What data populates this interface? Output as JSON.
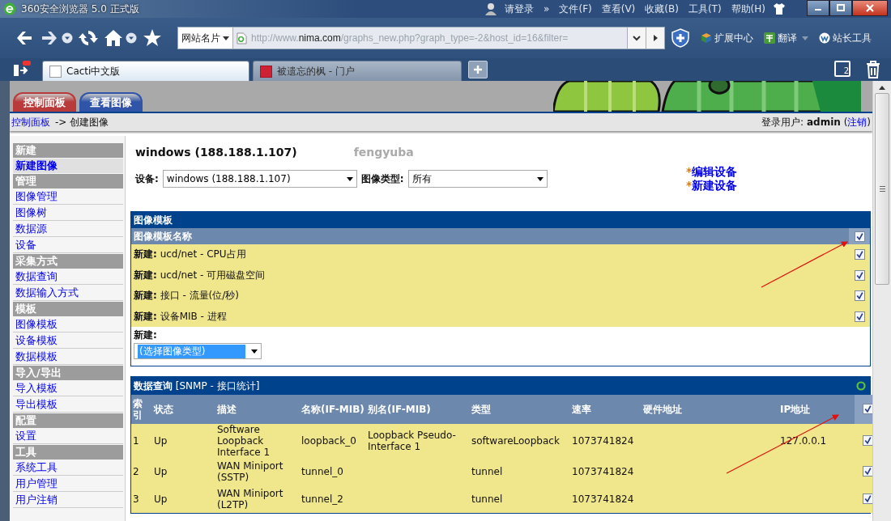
{
  "window": {
    "title": "360安全浏览器 5.0 正式版",
    "login": "请登录",
    "more": "»",
    "menus": [
      "文件(F)",
      "查看(V)",
      "收藏(B)",
      "工具(T)",
      "帮助(H)"
    ]
  },
  "navbar": {
    "site_card": "网站名片",
    "url_parts": [
      "http://www.",
      "nima.com",
      "/graphs_new.php?graph_type=-2&host_id=16&filter="
    ],
    "extensions": "扩展中心",
    "translate": "翻译",
    "webmaster": "站长工具"
  },
  "browser_tabs": [
    {
      "label": "Cacti中文版",
      "selected": true
    },
    {
      "label": "被遗忘的枫 - 门户",
      "selected": false
    }
  ],
  "window_count": "2",
  "app_tabs": [
    {
      "label": "控制面板",
      "color": "#b83a3a"
    },
    {
      "label": "查看图像",
      "color": "#2f54a8"
    }
  ],
  "breadcrumb": {
    "link": "控制面板",
    "current": "-> 创建图像",
    "login_text": "登录用户: **admin** (",
    "logout": "注销",
    "login_end": ")"
  },
  "sidebar": [
    {
      "kind": "header",
      "label": "新建",
      "selected": false
    },
    {
      "kind": "link",
      "label": "新建图像",
      "selected": true
    },
    {
      "kind": "header",
      "label": "管理",
      "selected": false
    },
    {
      "kind": "link",
      "label": "图像管理",
      "selected": false
    },
    {
      "kind": "link",
      "label": "图像树",
      "selected": false
    },
    {
      "kind": "link",
      "label": "数据源",
      "selected": false
    },
    {
      "kind": "link",
      "label": "设备",
      "selected": false
    },
    {
      "kind": "header",
      "label": "采集方式",
      "selected": false
    },
    {
      "kind": "link",
      "label": "数据查询",
      "selected": false
    },
    {
      "kind": "link",
      "label": "数据输入方式",
      "selected": false
    },
    {
      "kind": "header",
      "label": "模板",
      "selected": false
    },
    {
      "kind": "link",
      "label": "图像模板",
      "selected": false
    },
    {
      "kind": "link",
      "label": "设备模板",
      "selected": false
    },
    {
      "kind": "link",
      "label": "数据模板",
      "selected": false
    },
    {
      "kind": "header",
      "label": "导入/导出",
      "selected": false
    },
    {
      "kind": "link",
      "label": "导入模板",
      "selected": false
    },
    {
      "kind": "link",
      "label": "导出模板",
      "selected": false
    },
    {
      "kind": "header",
      "label": "配置",
      "selected": false
    },
    {
      "kind": "link",
      "label": "设置",
      "selected": false
    },
    {
      "kind": "header",
      "label": "工具",
      "selected": false
    },
    {
      "kind": "link",
      "label": "系统工具",
      "selected": false
    },
    {
      "kind": "link",
      "label": "用户管理",
      "selected": false
    },
    {
      "kind": "link",
      "label": "用户注销",
      "selected": false
    }
  ],
  "device": {
    "title": "windows (188.188.1.107)",
    "subtitle": "fengyuba",
    "device_label": "设备:",
    "device_value": "windows (188.188.1.107)",
    "type_label": "图像类型:",
    "type_value": "所有",
    "links": [
      {
        "mark": "*",
        "label": "编辑设备"
      },
      {
        "mark": "*",
        "label": "新建设备"
      }
    ]
  },
  "graph_templates": {
    "title": "图像模板",
    "column": "图像模板名称",
    "all_checked": true,
    "rows": [
      {
        "text": "**新建:** ucd/net - CPU占用",
        "checked": true
      },
      {
        "text": "**新建:** ucd/net - 可用磁盘空间",
        "checked": true
      },
      {
        "text": "**新建:** 接口 - 流量(位/秒)",
        "checked": true
      },
      {
        "text": "**新建:** 设备MIB - 进程",
        "checked": true
      }
    ],
    "new_label": "新建:",
    "new_select": "(选择图像类型)"
  },
  "data_query": {
    "title": "**数据查询** [SNMP - 接口统计]",
    "columns": [
      "索引",
      "状态",
      "描述",
      "名称(IF-MIB)",
      "别名(IF-MIB)",
      "类型",
      "速率",
      "硬件地址",
      "IP地址"
    ],
    "all_checked": true,
    "rows": [
      {
        "cells": [
          "1",
          "Up",
          "Software Loopback Interface 1",
          "loopback_0",
          "Loopback Pseudo-Interface 1",
          "softwareLoopback",
          "1073741824",
          null,
          "127.0.0.1"
        ],
        "checked": true
      },
      {
        "cells": [
          "2",
          "Up",
          "WAN Miniport (SSTP)",
          "tunnel_0",
          null,
          "tunnel",
          "1073741824",
          null,
          null
        ],
        "checked": true
      },
      {
        "cells": [
          "3",
          "Up",
          "WAN Miniport (L2TP)",
          "tunnel_2",
          null,
          "tunnel",
          "1073741824",
          null,
          null
        ],
        "checked": true
      }
    ]
  }
}
